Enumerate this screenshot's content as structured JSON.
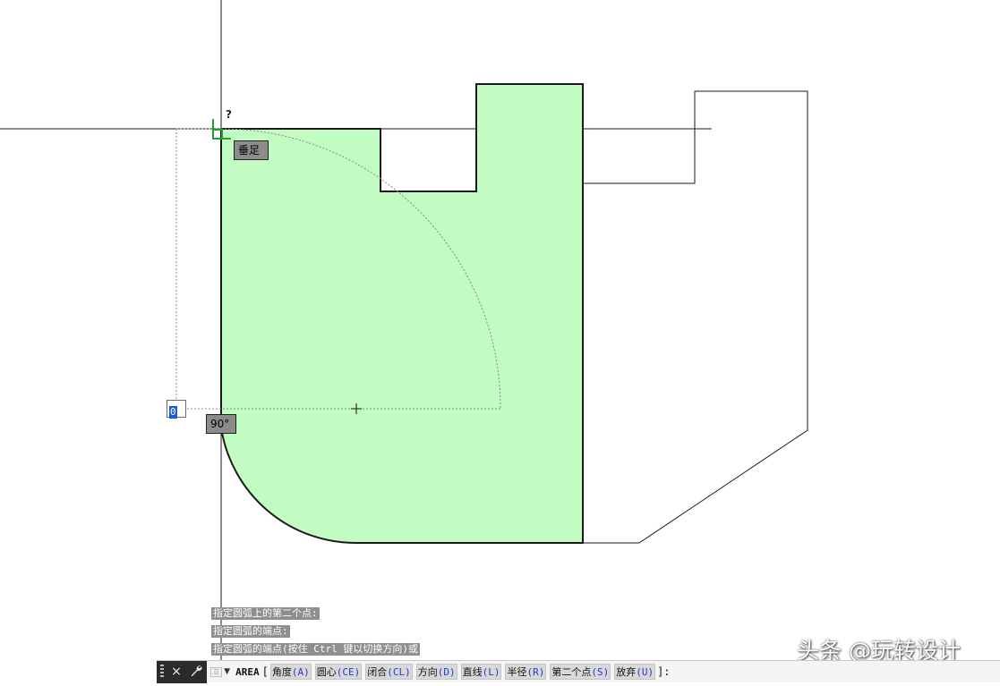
{
  "canvas": {
    "snap_tooltip": "垂足",
    "angle_tooltip": "90°",
    "dynamic_input_value": "0",
    "help_marker": "?",
    "fill_color": "#c3fcc3",
    "line_color": "#1a1a1a",
    "snap_marker_color": "#1fa12f"
  },
  "command_history": [
    "指定圆弧上的第二个点:",
    "指定圆弧的端点:",
    "指定圆弧的端点(按住 Ctrl 键以切换方向)或"
  ],
  "command_line": {
    "close_icon": "×",
    "customize_icon": "wrench-icon",
    "history_button": "☰",
    "command": "AREA",
    "open_bracket": "[",
    "close_bracket": "]:",
    "options": [
      {
        "label": "角度",
        "key": "(A)"
      },
      {
        "label": "圆心",
        "key": "(CE)"
      },
      {
        "label": "闭合",
        "key": "(CL)"
      },
      {
        "label": "方向",
        "key": "(D)"
      },
      {
        "label": "直线",
        "key": "(L)"
      },
      {
        "label": "半径",
        "key": "(R)"
      },
      {
        "label": "第二个点",
        "key": "(S)"
      },
      {
        "label": "放弃",
        "key": "(U)"
      }
    ]
  },
  "watermark": "头条 @玩转设计"
}
